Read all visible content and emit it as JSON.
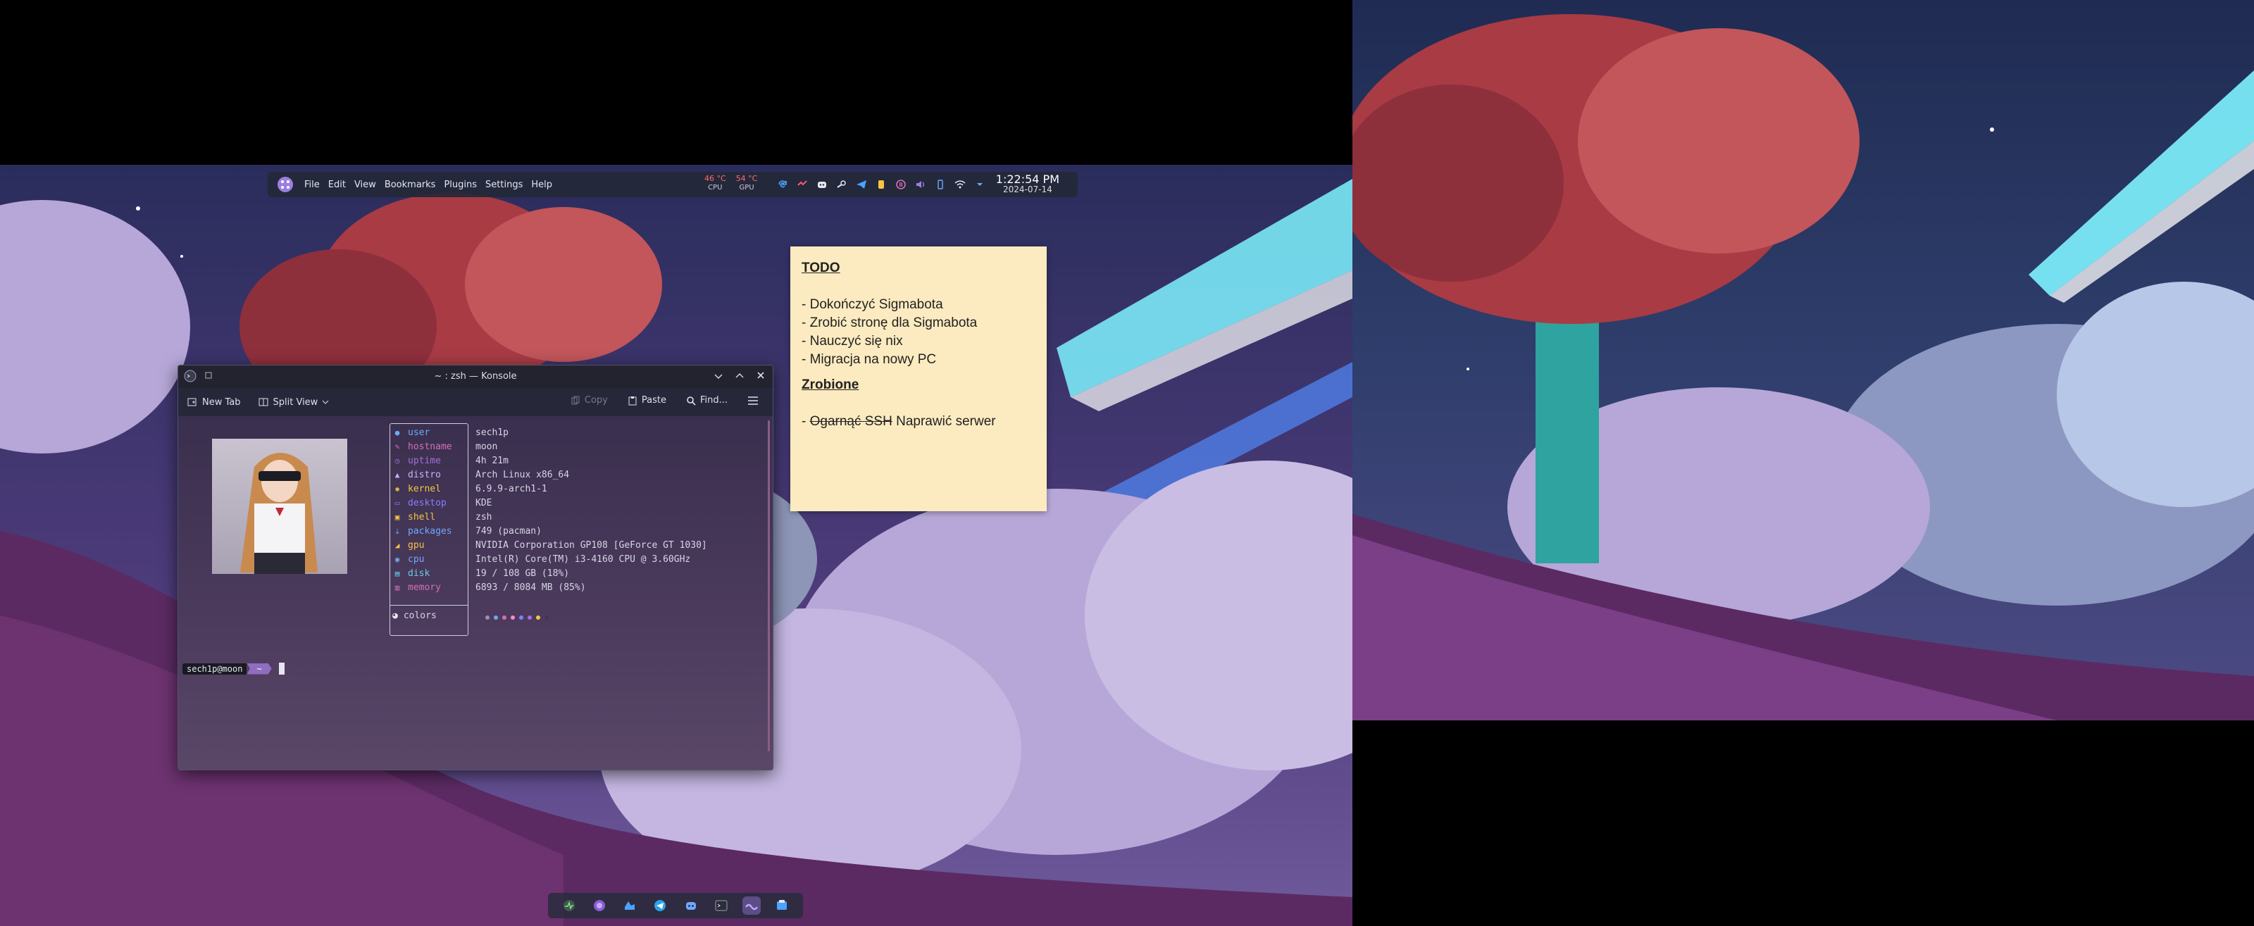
{
  "panel": {
    "menu": [
      "File",
      "Edit",
      "View",
      "Bookmarks",
      "Plugins",
      "Settings",
      "Help"
    ],
    "cpu_temp": "46 °C",
    "cpu_label": "CPU",
    "gpu_temp": "54 °C",
    "gpu_label": "GPU",
    "tray_icons": [
      "update-icon",
      "game-icon",
      "discord-icon",
      "steam-icon",
      "telegram-icon",
      "vpn-icon",
      "clipboard-icon",
      "media-pause-icon",
      "volume-icon",
      "network-icon",
      "battery-icon",
      "expand-tray-icon"
    ],
    "time": "1:22:54 PM",
    "date": "2024-07-14"
  },
  "konsole": {
    "title": "~ : zsh — Konsole",
    "toolbar": {
      "new_tab": "New Tab",
      "split_view": "Split View",
      "copy": "Copy",
      "paste": "Paste",
      "find": "Find..."
    },
    "fetch": {
      "labels": [
        "user",
        "hostname",
        "uptime",
        "distro",
        "kernel",
        "desktop",
        "shell",
        "packages",
        "gpu",
        "cpu",
        "disk",
        "memory"
      ],
      "values": [
        "sech1p",
        "moon",
        "4h 21m",
        "Arch Linux x86_64",
        "6.9.9-arch1-1",
        "KDE",
        "zsh",
        "749 (pacman)",
        "NVIDIA Corporation GP108 [GeForce GT 1030]",
        "Intel(R) Core(TM) i3-4160 CPU @ 3.60GHz",
        "19 / 108 GB (18%)",
        "6893 / 8084 MB (85%)"
      ],
      "label_colors": [
        "#6ea8fe",
        "#d36fb8",
        "#a36fd3",
        "#c7b3ff",
        "#f5c542",
        "#8a7cff",
        "#f5c542",
        "#6ea8fe",
        "#f5c542",
        "#6ea8fe",
        "#6ec9e8",
        "#d36fb8"
      ],
      "colors_label": "colors",
      "dot_colors": [
        "#9a8fb0",
        "#6ea8fe",
        "#d36fb8",
        "#f58acb",
        "#8a7cff",
        "#a36fd3",
        "#f5c542",
        "#3b3b4a"
      ]
    },
    "prompt": {
      "user": "sech1p@moon",
      "dir": "~"
    }
  },
  "note": {
    "todo_header": "TODO",
    "todo_items": [
      "- Dokończyć Sigmabota",
      "- Zrobić stronę dla Sigmabota",
      "- Nauczyć się nix",
      "- Migracja na nowy PC"
    ],
    "done_header": "Zrobione",
    "done_prefix": "- ",
    "done_struck": "Ogarnąć SSH",
    "done_rest": " Naprawić serwer"
  },
  "dock": {
    "icons": [
      "system-monitor-icon",
      "browser-icon",
      "file-manager-icon",
      "telegram-icon",
      "discord-icon",
      "terminal-icon",
      "editor-icon",
      "settings-icon"
    ]
  },
  "colors": {
    "sky_top": "#2a2d5c",
    "sky_mid": "#4d3b7a",
    "hill": "#5b2a62",
    "cloud": "#b6a7d8",
    "foliage": "#a83b44",
    "trunk": "#2fa3a0"
  }
}
